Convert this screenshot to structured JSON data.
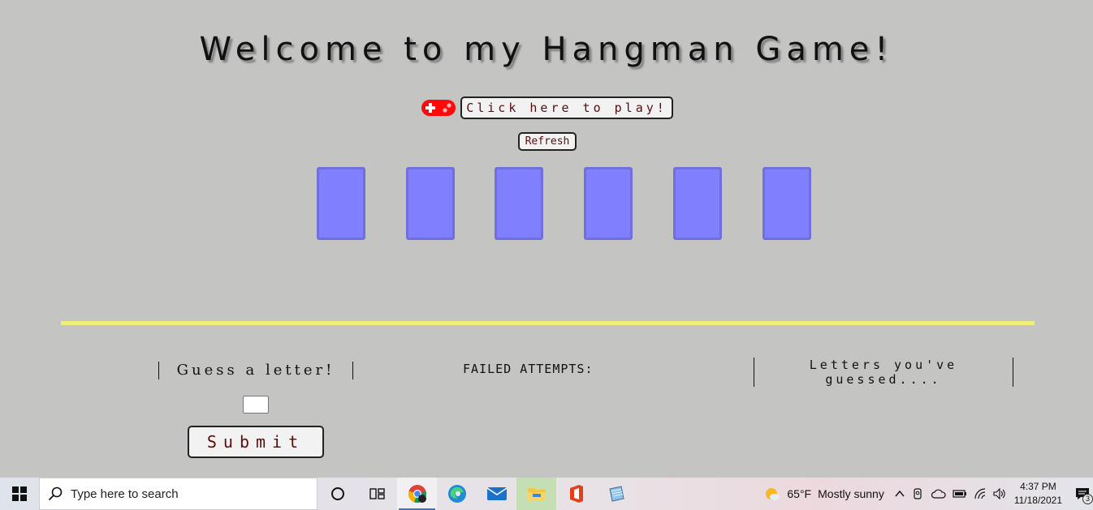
{
  "game": {
    "title": "Welcome to my Hangman Game!",
    "play_button": "Click here to play!",
    "refresh_button": "Refresh",
    "guess_label": "Guess a letter!",
    "guess_input_value": "",
    "submit_button": "Submit",
    "failed_label": "FAILED ATTEMPTS:",
    "letters_label": "Letters you've guessed....",
    "tile_count": 6,
    "colors": {
      "background": "#c4c4c3",
      "tile_fill": "#8080ff",
      "divider": "#f0ef7a",
      "button_text": "#5a0c0c",
      "gamepad": "#ff0000"
    }
  },
  "taskbar": {
    "search_placeholder": "Type here to search",
    "apps": [
      "task-view",
      "chrome",
      "edge",
      "mail",
      "file-explorer",
      "office",
      "notepad"
    ],
    "weather_temp": "65°F",
    "weather_text": "Mostly sunny",
    "time": "4:37 PM",
    "date": "11/18/2021",
    "notification_count": "3"
  }
}
